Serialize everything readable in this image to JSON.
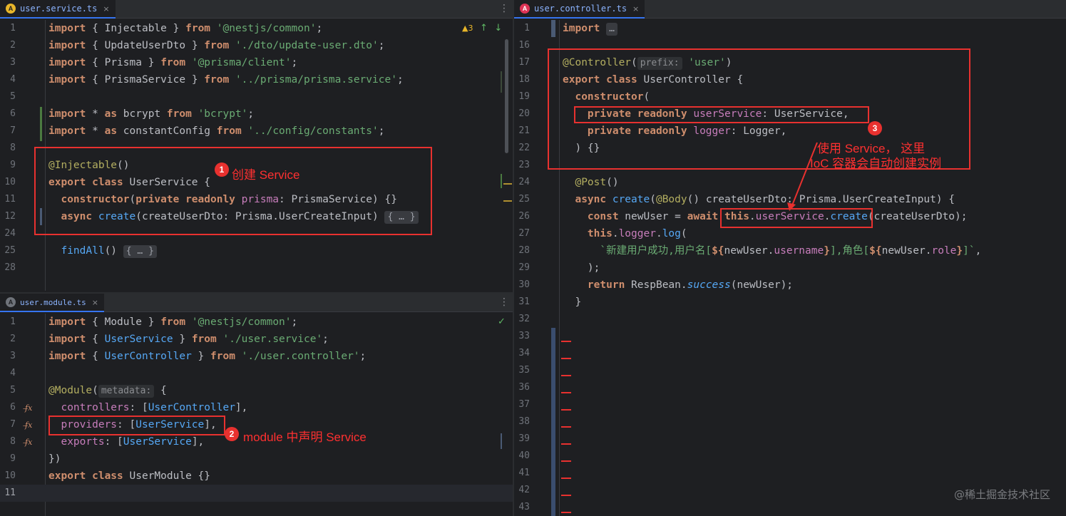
{
  "tabs": {
    "service": {
      "icon": "A",
      "label": "user.service.ts",
      "close": "×"
    },
    "module": {
      "icon": "A",
      "label": "user.module.ts",
      "close": "×"
    },
    "controller": {
      "icon": "A",
      "label": "user.controller.ts",
      "close": "×"
    }
  },
  "inspection": {
    "warnings": "▲3",
    "up": "↑",
    "down": "↓",
    "ok": "✓"
  },
  "menu": "⋮",
  "service_lines": [
    {
      "n": "1"
    },
    {
      "n": "2"
    },
    {
      "n": "3"
    },
    {
      "n": "4"
    },
    {
      "n": "5"
    },
    {
      "n": "6"
    },
    {
      "n": "7"
    },
    {
      "n": "8"
    },
    {
      "n": "9"
    },
    {
      "n": "10"
    },
    {
      "n": "11"
    },
    {
      "n": "12"
    },
    {
      "n": "24"
    },
    {
      "n": "25"
    },
    {
      "n": "28"
    }
  ],
  "service_code": {
    "l1": [
      "import",
      " { ",
      "Injectable",
      " } ",
      "from",
      " ",
      "'@nestjs/common'",
      ";"
    ],
    "l2": [
      "import",
      " { ",
      "UpdateUserDto",
      " } ",
      "from",
      " ",
      "'./dto/update-user.dto'",
      ";"
    ],
    "l3": [
      "import",
      " { ",
      "Prisma",
      " } ",
      "from",
      " ",
      "'@prisma/client'",
      ";"
    ],
    "l4": [
      "import",
      " { ",
      "PrismaService",
      " } ",
      "from",
      " ",
      "'../prisma/prisma.service'",
      ";"
    ],
    "l6": [
      "import",
      " * ",
      "as",
      " bcrypt ",
      "from",
      " ",
      "'bcrypt'",
      ";"
    ],
    "l7": [
      "import",
      " * ",
      "as",
      " constantConfig ",
      "from",
      " ",
      "'../config/constants'",
      ";"
    ],
    "l9": [
      "@Injectable",
      "()"
    ],
    "l10": [
      "export class",
      " ",
      "UserService",
      " {"
    ],
    "l11": [
      "  constructor",
      "(",
      "private readonly",
      " ",
      "prisma",
      ": ",
      "PrismaService",
      ") {}"
    ],
    "l12": [
      "  async",
      " ",
      "create",
      "(createUserDto: Prisma.UserCreateInput) ",
      "{ … }"
    ],
    "l25": [
      "  findAll",
      "() ",
      "{ … }"
    ]
  },
  "module_lines": [
    {
      "n": "1"
    },
    {
      "n": "2"
    },
    {
      "n": "3"
    },
    {
      "n": "4"
    },
    {
      "n": "5"
    },
    {
      "n": "6"
    },
    {
      "n": "7"
    },
    {
      "n": "8"
    },
    {
      "n": "9"
    },
    {
      "n": "10"
    },
    {
      "n": "11"
    }
  ],
  "module_code": {
    "l1": [
      "import",
      " { ",
      "Module",
      " } ",
      "from",
      " ",
      "'@nestjs/common'",
      ";"
    ],
    "l2": [
      "import",
      " { ",
      "UserService",
      " } ",
      "from",
      " ",
      "'./user.service'",
      ";"
    ],
    "l3": [
      "import",
      " { ",
      "UserController",
      " } ",
      "from",
      " ",
      "'./user.controller'",
      ";"
    ],
    "l5": [
      "@Module",
      "(",
      "metadata:",
      " {"
    ],
    "l6": [
      "  controllers",
      ": [",
      "UserController",
      "],"
    ],
    "l7": [
      "  providers",
      ": [",
      "UserService",
      "],"
    ],
    "l8": [
      "  exports",
      ": [",
      "UserService",
      "],"
    ],
    "l9": [
      "})"
    ],
    "l10": [
      "export class",
      " ",
      "UserModule",
      " {}"
    ],
    "fx": "f̶x"
  },
  "controller_lines": [
    {
      "n": "1"
    },
    {
      "n": "16"
    },
    {
      "n": "17"
    },
    {
      "n": "18"
    },
    {
      "n": "19"
    },
    {
      "n": "20"
    },
    {
      "n": "21"
    },
    {
      "n": "22"
    },
    {
      "n": "23"
    },
    {
      "n": "24"
    },
    {
      "n": "25"
    },
    {
      "n": "26"
    },
    {
      "n": "27"
    },
    {
      "n": "28"
    },
    {
      "n": "29"
    },
    {
      "n": "30"
    },
    {
      "n": "31"
    },
    {
      "n": "32"
    },
    {
      "n": "33"
    },
    {
      "n": "34"
    },
    {
      "n": "35"
    },
    {
      "n": "36"
    },
    {
      "n": "37"
    },
    {
      "n": "38"
    },
    {
      "n": "39"
    },
    {
      "n": "40"
    },
    {
      "n": "41"
    },
    {
      "n": "42"
    },
    {
      "n": "43"
    }
  ],
  "controller_code": {
    "l1": [
      "import",
      " ",
      "…"
    ],
    "l17": [
      "@Controller",
      "(",
      "prefix:",
      " ",
      "'user'",
      ")"
    ],
    "l18": [
      "export class",
      " ",
      "UserController",
      " {"
    ],
    "l19": [
      "  constructor",
      "("
    ],
    "l20": [
      "    private readonly",
      " ",
      "userService",
      ": ",
      "UserService",
      ","
    ],
    "l21": [
      "    private readonly",
      " ",
      "logger",
      ": ",
      "Logger",
      ","
    ],
    "l22": [
      "  ) {}"
    ],
    "l24": [
      "  @Post",
      "()"
    ],
    "l25": [
      "  async",
      " ",
      "create",
      "(",
      "@Body",
      "() createUserDto: Prisma.UserCreateInput) {"
    ],
    "l26": [
      "    const",
      " newUser = ",
      "await",
      " ",
      "this",
      ".",
      "userService",
      ".",
      "create",
      "(createUserDto);"
    ],
    "l27": [
      "    this",
      ".",
      "logger",
      ".",
      "log",
      "("
    ],
    "l28": [
      "      `新建用户成功,用户名[",
      "${",
      "newUser",
      ".",
      "username",
      "}",
      "],角色[",
      "${",
      "newUser",
      ".",
      "role",
      "}",
      "]`",
      ","
    ],
    "l29": [
      "    );"
    ],
    "l30": [
      "    return",
      " RespBean.",
      "success",
      "(newUser);"
    ],
    "l31": [
      "  }"
    ]
  },
  "annotations": {
    "a1": {
      "num": "1",
      "text": "创建 Service"
    },
    "a2": {
      "num": "2",
      "text": "module 中声明 Service"
    },
    "a3": {
      "num": "3",
      "text1": "使用 Service，  这里",
      "text2": "IoC 容器会自动创建实例"
    }
  },
  "colors": {
    "accent": "#3574f0",
    "annotation": "#e8312f",
    "keyword": "#cf8e6d",
    "string": "#6aab73",
    "method": "#56a8f5",
    "field": "#c77dbb"
  },
  "watermark": "@稀土掘金技术社区"
}
